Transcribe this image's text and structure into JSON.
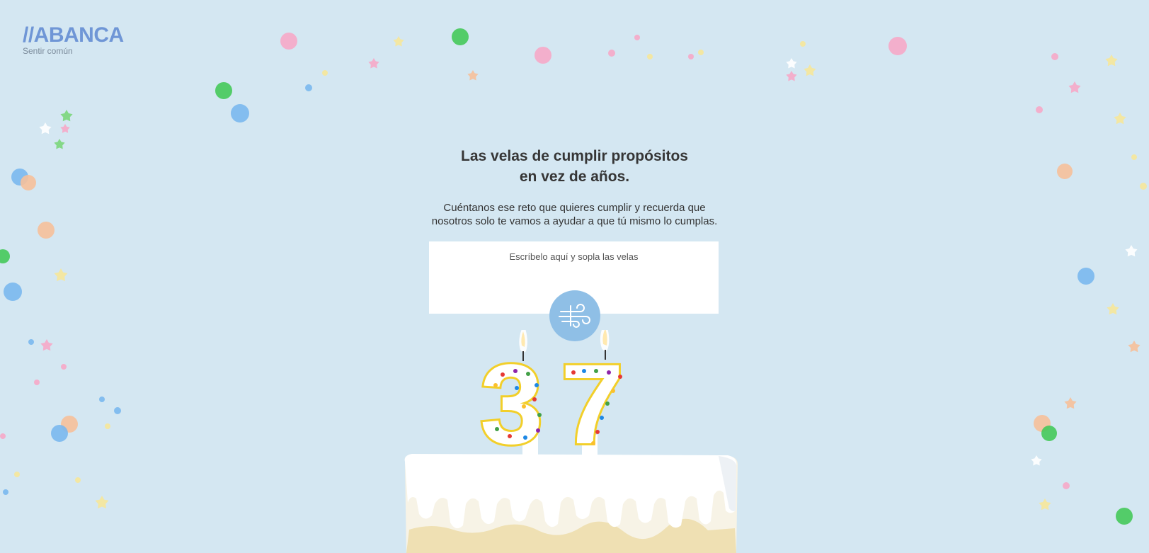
{
  "brand": {
    "logo_text": "//ABANCA",
    "tagline": "Sentir común"
  },
  "hero": {
    "title_line1": "Las velas de cumplir propósitos",
    "title_line2": "en vez de años.",
    "subtitle_line1": "Cuéntanos ese reto que quieres cumplir y recuerda que",
    "subtitle_line2": "nosotros solo te vamos a ayudar a que tú mismo lo cumplas."
  },
  "wish_input": {
    "placeholder": "Escríbelo aquí y sopla las velas",
    "value": ""
  },
  "blow_button": {
    "icon": "wind-icon"
  },
  "candles": {
    "digit1": "3",
    "digit2": "7"
  },
  "colors": {
    "background": "#d4e7f2",
    "brand": "#6f96d6",
    "button": "#8fbfe6",
    "candle_outline": "#f2cf2a"
  }
}
